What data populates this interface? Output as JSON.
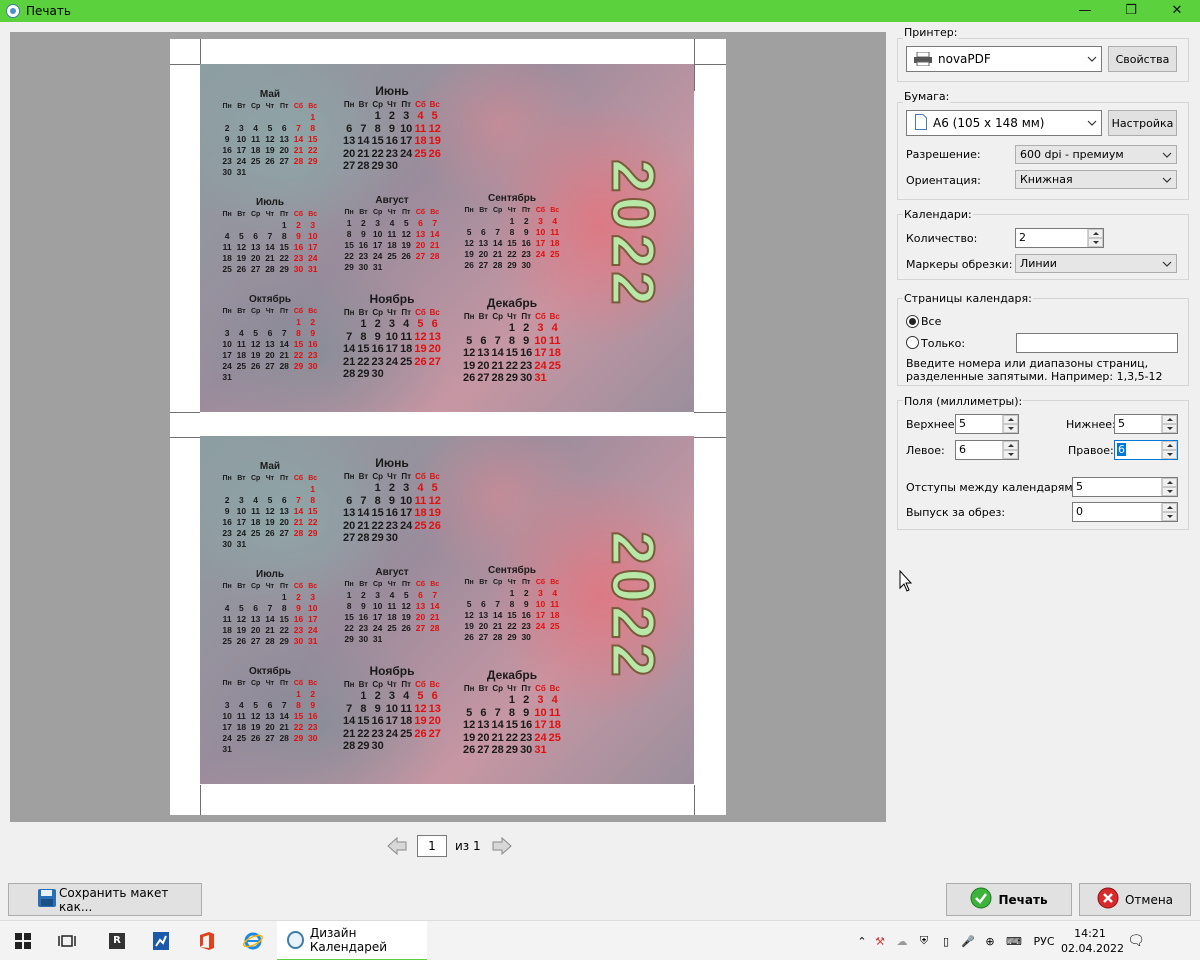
{
  "window": {
    "title": "Печать",
    "minimize": "—",
    "restore": "❐",
    "close": "✕"
  },
  "preview": {
    "year": "2022",
    "dow": [
      "Пн",
      "Вт",
      "Ср",
      "Чт",
      "Пт",
      "Сб",
      "Вс"
    ],
    "months": [
      {
        "name": "Май",
        "weeks": [
          [
            "",
            "",
            "",
            "",
            "",
            "",
            "1"
          ],
          [
            "2",
            "3",
            "4",
            "5",
            "6",
            "7",
            "8"
          ],
          [
            "9",
            "10",
            "11",
            "12",
            "13",
            "14",
            "15"
          ],
          [
            "16",
            "17",
            "18",
            "19",
            "20",
            "21",
            "22"
          ],
          [
            "23",
            "24",
            "25",
            "26",
            "27",
            "28",
            "29"
          ],
          [
            "30",
            "31",
            "",
            "",
            "",
            "",
            ""
          ]
        ]
      },
      {
        "name": "Июнь",
        "weeks": [
          [
            "",
            "",
            "1",
            "2",
            "3",
            "4",
            "5"
          ],
          [
            "6",
            "7",
            "8",
            "9",
            "10",
            "11",
            "12"
          ],
          [
            "13",
            "14",
            "15",
            "16",
            "17",
            "18",
            "19"
          ],
          [
            "20",
            "21",
            "22",
            "23",
            "24",
            "25",
            "26"
          ],
          [
            "27",
            "28",
            "29",
            "30",
            "",
            "",
            ""
          ]
        ]
      },
      {
        "name": "Июль",
        "weeks": [
          [
            "",
            "",
            "",
            "",
            "1",
            "2",
            "3"
          ],
          [
            "4",
            "5",
            "6",
            "7",
            "8",
            "9",
            "10"
          ],
          [
            "11",
            "12",
            "13",
            "14",
            "15",
            "16",
            "17"
          ],
          [
            "18",
            "19",
            "20",
            "21",
            "22",
            "23",
            "24"
          ],
          [
            "25",
            "26",
            "27",
            "28",
            "29",
            "30",
            "31"
          ]
        ]
      },
      {
        "name": "Август",
        "weeks": [
          [
            "1",
            "2",
            "3",
            "4",
            "5",
            "6",
            "7"
          ],
          [
            "8",
            "9",
            "10",
            "11",
            "12",
            "13",
            "14"
          ],
          [
            "15",
            "16",
            "17",
            "18",
            "19",
            "20",
            "21"
          ],
          [
            "22",
            "23",
            "24",
            "25",
            "26",
            "27",
            "28"
          ],
          [
            "29",
            "30",
            "31",
            "",
            "",
            "",
            ""
          ]
        ]
      },
      {
        "name": "Сентябрь",
        "weeks": [
          [
            "",
            "",
            "",
            "1",
            "2",
            "3",
            "4"
          ],
          [
            "5",
            "6",
            "7",
            "8",
            "9",
            "10",
            "11"
          ],
          [
            "12",
            "13",
            "14",
            "15",
            "16",
            "17",
            "18"
          ],
          [
            "19",
            "20",
            "21",
            "22",
            "23",
            "24",
            "25"
          ],
          [
            "26",
            "27",
            "28",
            "29",
            "30",
            "",
            ""
          ]
        ]
      },
      {
        "name": "Октябрь",
        "weeks": [
          [
            "",
            "",
            "",
            "",
            "",
            "1",
            "2"
          ],
          [
            "3",
            "4",
            "5",
            "6",
            "7",
            "8",
            "9"
          ],
          [
            "10",
            "11",
            "12",
            "13",
            "14",
            "15",
            "16"
          ],
          [
            "17",
            "18",
            "19",
            "20",
            "21",
            "22",
            "23"
          ],
          [
            "24",
            "25",
            "26",
            "27",
            "28",
            "29",
            "30"
          ],
          [
            "31",
            "",
            "",
            "",
            "",
            "",
            ""
          ]
        ]
      },
      {
        "name": "Ноябрь",
        "weeks": [
          [
            "",
            "1",
            "2",
            "3",
            "4",
            "5",
            "6"
          ],
          [
            "7",
            "8",
            "9",
            "10",
            "11",
            "12",
            "13"
          ],
          [
            "14",
            "15",
            "16",
            "17",
            "18",
            "19",
            "20"
          ],
          [
            "21",
            "22",
            "23",
            "24",
            "25",
            "26",
            "27"
          ],
          [
            "28",
            "29",
            "30",
            "",
            "",
            "",
            ""
          ]
        ]
      },
      {
        "name": "Декабрь",
        "weeks": [
          [
            "",
            "",
            "",
            "1",
            "2",
            "3",
            "4"
          ],
          [
            "5",
            "6",
            "7",
            "8",
            "9",
            "10",
            "11"
          ],
          [
            "12",
            "13",
            "14",
            "15",
            "16",
            "17",
            "18"
          ],
          [
            "19",
            "20",
            "21",
            "22",
            "23",
            "24",
            "25"
          ],
          [
            "26",
            "27",
            "28",
            "29",
            "30",
            "31",
            ""
          ]
        ]
      }
    ]
  },
  "pager": {
    "page": "1",
    "of_text": "из 1"
  },
  "printer": {
    "group_label": "Принтер:",
    "selected": "novaPDF",
    "properties_button": "Свойства"
  },
  "paper": {
    "group_label": "Бумага:",
    "size": "A6 (105 x 148 мм)",
    "setup_button": "Настройка",
    "resolution_label": "Разрешение:",
    "resolution": "600 dpi - премиум",
    "orientation_label": "Ориентация:",
    "orientation": "Книжная"
  },
  "calendars": {
    "group_label": "Календари:",
    "count_label": "Количество:",
    "count": "2",
    "markers_label": "Маркеры обрезки:",
    "markers": "Линии"
  },
  "pages": {
    "group_label": "Страницы календаря:",
    "all_label": "Все",
    "only_label": "Только:",
    "only_value": "",
    "hint": "Введите номера или диапазоны страниц, разделенные запятыми. Например: 1,3,5-12"
  },
  "margins": {
    "group_label": "Поля (миллиметры):",
    "top_label": "Верхнее:",
    "top": "5",
    "bottom_label": "Нижнее:",
    "bottom": "5",
    "left_label": "Левое:",
    "left": "6",
    "right_label": "Правое:",
    "right": "6",
    "gap_label": "Отступы между календарями:",
    "gap": "5",
    "bleed_label": "Выпуск за обрез:",
    "bleed": "0"
  },
  "bottom": {
    "save_layout": "Сохранить макет как...",
    "print": "Печать",
    "cancel": "Отмена"
  },
  "taskbar": {
    "active_app": "Дизайн Календарей",
    "lang": "РУС",
    "time": "14:21",
    "date": "02.04.2022"
  }
}
